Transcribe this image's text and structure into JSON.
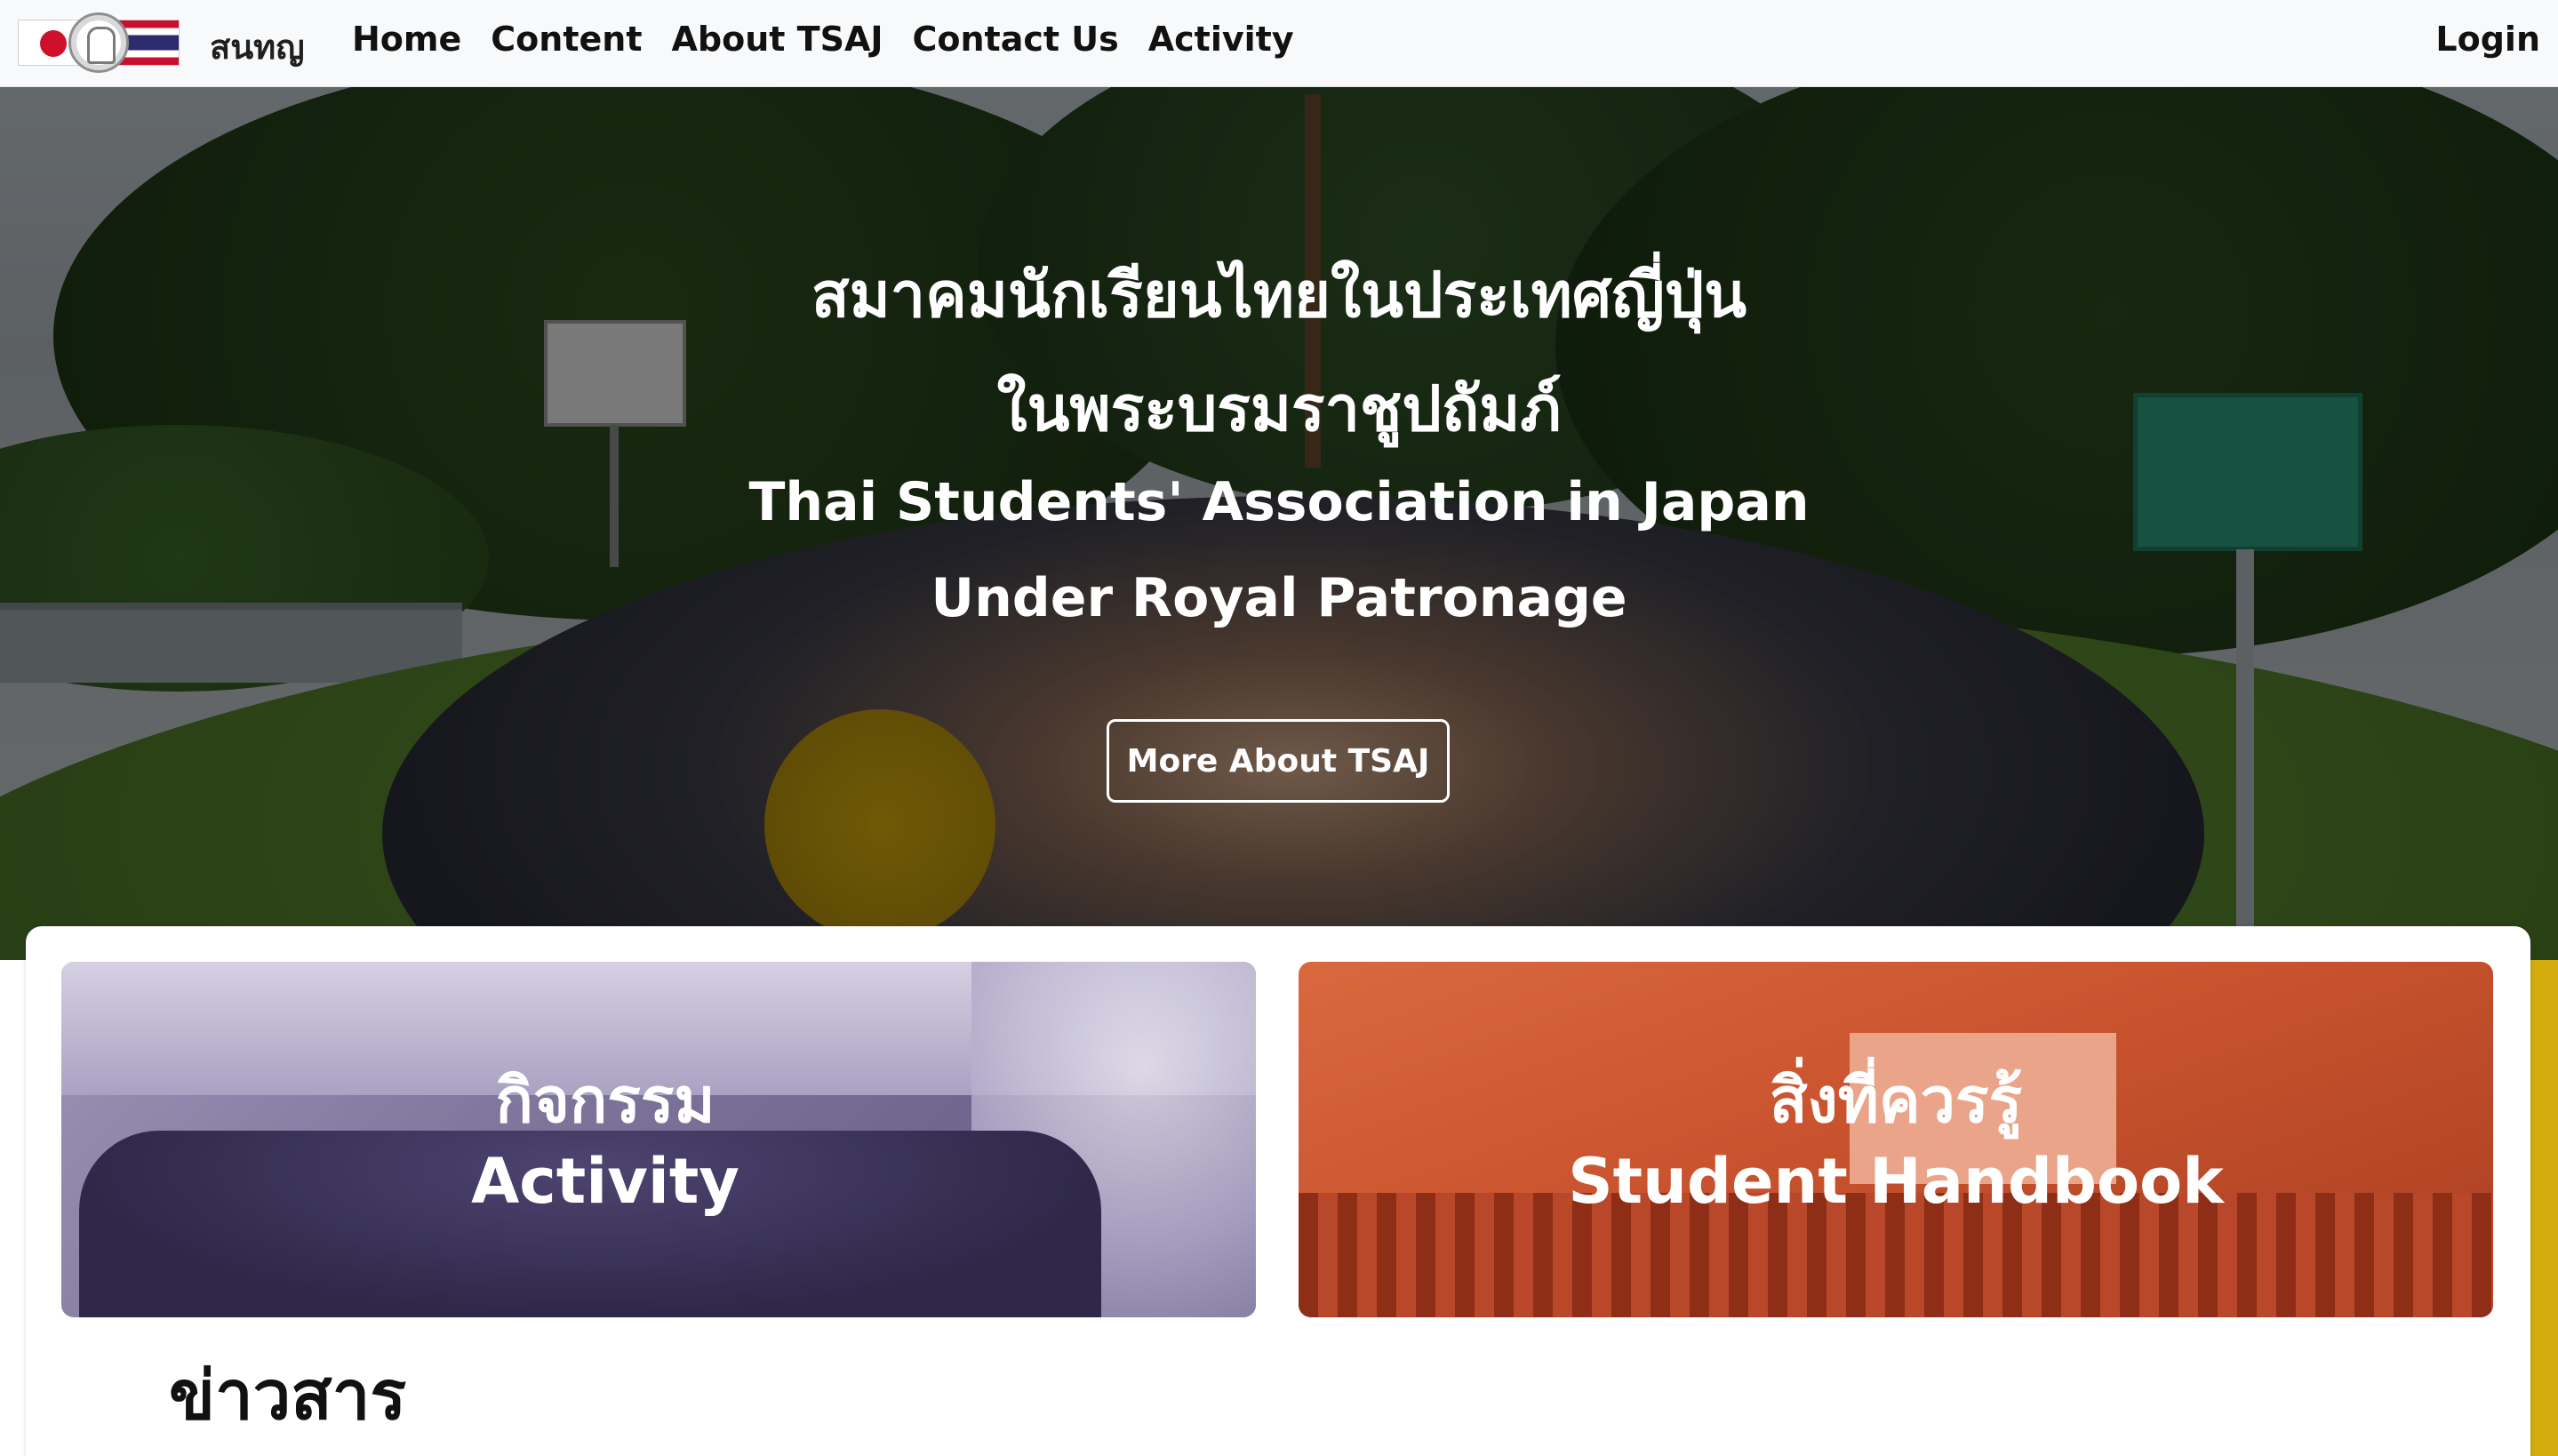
{
  "navbar": {
    "brand": "สนทญ",
    "links": [
      "Home",
      "Content",
      "About TSAJ",
      "Contact Us",
      "Activity"
    ],
    "login": "Login"
  },
  "hero": {
    "title_th_1": "สมาคมนักเรียนไทยในประเทศญี่ปุ่น",
    "title_th_2": "ในพระบรมราชูปถัมภ์",
    "title_en_1": "Thai Students' Association in Japan",
    "title_en_2": "Under Royal Patronage",
    "button": "More About TSAJ"
  },
  "tiles": [
    {
      "title_th": "กิจกรรม",
      "title_en": "Activity"
    },
    {
      "title_th": "สิ่งที่ควรรู้",
      "title_en": "Student Handbook"
    }
  ],
  "news": {
    "heading": "ข่าวสาร"
  },
  "colors": {
    "accent_gold": "#d4ac0d",
    "activity_tint": "#7c7299",
    "handbook_tint": "#c9532e"
  }
}
